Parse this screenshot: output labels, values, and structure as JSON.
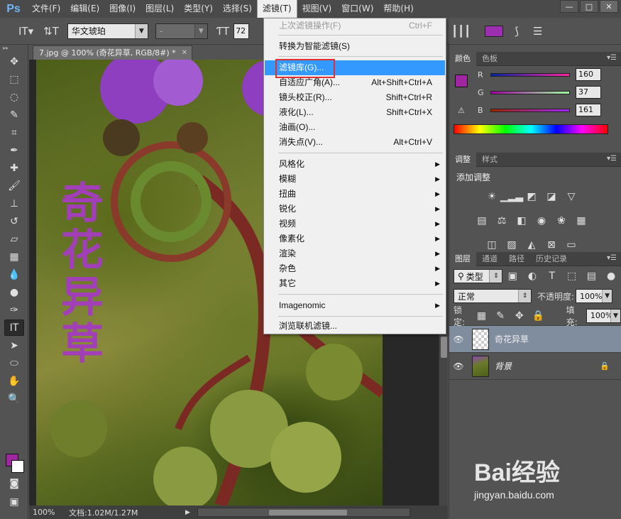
{
  "menubar": {
    "logo": "Ps",
    "items": [
      "文件(F)",
      "编辑(E)",
      "图像(I)",
      "图层(L)",
      "类型(Y)",
      "选择(S)",
      "滤镜(T)",
      "视图(V)",
      "窗口(W)",
      "帮助(H)"
    ],
    "active_index": 6
  },
  "window_controls": {
    "minimize": "—",
    "maximize": "□",
    "close": "✕"
  },
  "options": {
    "font_family": "华文琥珀",
    "font_style": "-",
    "font_size": "72",
    "text_color": "#9b2fb0"
  },
  "document": {
    "tab_title": "7.jpg @ 100% (奇花异草, RGB/8#) *",
    "canvas_text": [
      "奇",
      "花",
      "异",
      "草"
    ],
    "text_color": "#a23fb8"
  },
  "status": {
    "zoom": "100%",
    "doc_info": "文档:1.02M/1.27M"
  },
  "color_panel": {
    "tabs": [
      "颜色",
      "色板"
    ],
    "r_label": "R",
    "g_label": "G",
    "b_label": "B",
    "r": "160",
    "g": "37",
    "b": "161",
    "swatch": "#a025a1"
  },
  "adjust_panel": {
    "tabs": [
      "调整",
      "样式"
    ],
    "title": "添加调整"
  },
  "layers_panel": {
    "tabs": [
      "图层",
      "通道",
      "路径",
      "历史记录"
    ],
    "filter_type": "类型",
    "blend_mode": "正常",
    "opacity_label": "不透明度:",
    "opacity": "100%",
    "lock_label": "锁定:",
    "fill_label": "填充:",
    "fill": "100%",
    "layers": [
      {
        "name": "奇花异草",
        "selected": true
      },
      {
        "name": "背景",
        "selected": false
      }
    ]
  },
  "filter_menu": {
    "last_filter": "上次滤镜操作(F)",
    "last_filter_sc": "Ctrl+F",
    "smart": "转换为智能滤镜(S)",
    "gallery": "滤镜库(G)...",
    "adaptive": "自适应广角(A)...",
    "adaptive_sc": "Alt+Shift+Ctrl+A",
    "lens": "镜头校正(R)...",
    "lens_sc": "Shift+Ctrl+R",
    "liquify": "液化(L)...",
    "liquify_sc": "Shift+Ctrl+X",
    "oil": "油画(O)...",
    "vanish": "消失点(V)...",
    "vanish_sc": "Alt+Ctrl+V",
    "sub": [
      "风格化",
      "模糊",
      "扭曲",
      "锐化",
      "视频",
      "像素化",
      "渲染",
      "杂色",
      "其它"
    ],
    "imagenomic": "Imagenomic",
    "browse": "浏览联机滤镜..."
  },
  "watermark": {
    "brand": "Bai经验",
    "url": "jingyan.baidu.com"
  }
}
